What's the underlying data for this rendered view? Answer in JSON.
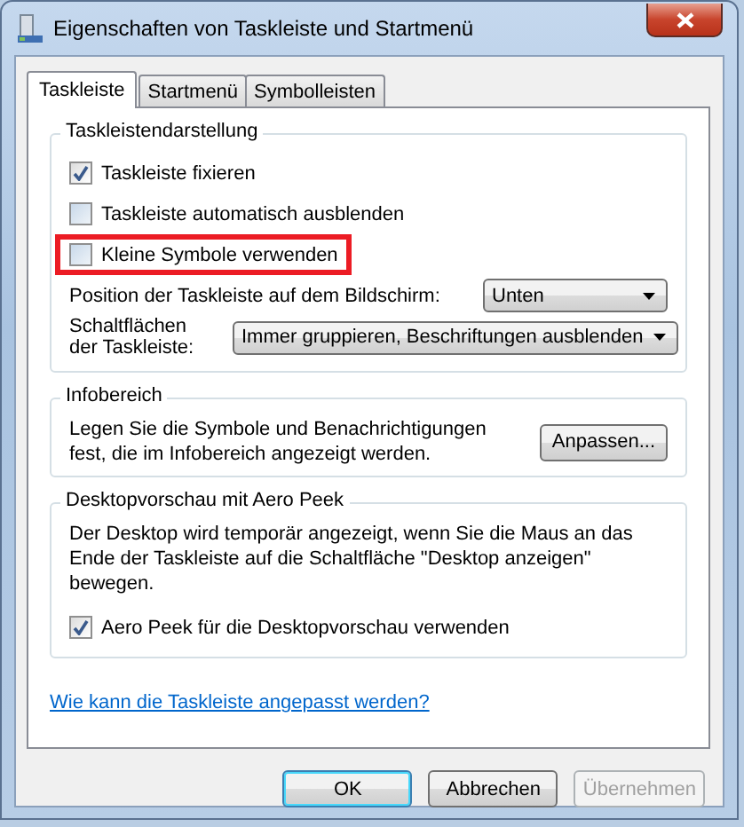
{
  "window": {
    "title": "Eigenschaften von Taskleiste und Startmenü"
  },
  "tabs": [
    {
      "label": "Taskleiste",
      "selected": true
    },
    {
      "label": "Startmenü",
      "selected": false
    },
    {
      "label": "Symbolleisten",
      "selected": false
    }
  ],
  "groups": [
    {
      "title": "Taskleistendarstellung",
      "items": [
        {
          "kind": "checkbox",
          "label": "Taskleiste fixieren",
          "checked": true,
          "highlighted": false
        },
        {
          "kind": "checkbox",
          "label": "Taskleiste automatisch ausblenden",
          "checked": false,
          "highlighted": false
        },
        {
          "kind": "checkbox",
          "label": "Kleine Symbole verwenden",
          "checked": false,
          "highlighted": true
        },
        {
          "kind": "dropdown",
          "label": "Position der Taskleiste auf dem Bildschirm:",
          "value": "Unten"
        },
        {
          "kind": "dropdown",
          "label": "Schaltflächen der Taskleiste:",
          "value": "Immer gruppieren, Beschriftungen ausblenden"
        }
      ]
    },
    {
      "title": "Infobereich",
      "items": [
        {
          "kind": "text_button",
          "text": "Legen Sie die Symbole und Benachrichtigungen fest, die im Infobereich angezeigt werden.",
          "button": "Anpassen..."
        }
      ]
    },
    {
      "title": "Desktopvorschau mit Aero Peek",
      "items": [
        {
          "kind": "paragraph",
          "text": "Der Desktop wird temporär angezeigt, wenn Sie die Maus an das Ende der Taskleiste auf die Schaltfläche \"Desktop anzeigen\" bewegen."
        },
        {
          "kind": "checkbox",
          "label": "Aero Peek für die Desktopvorschau verwenden",
          "checked": true,
          "highlighted": false
        }
      ]
    }
  ],
  "help_link": "Wie kann die Taskleiste angepasst werden?",
  "buttons": [
    {
      "label": "OK",
      "default": true,
      "disabled": false
    },
    {
      "label": "Abbrechen",
      "default": false,
      "disabled": false
    },
    {
      "label": "Übernehmen",
      "default": false,
      "disabled": true
    }
  ]
}
